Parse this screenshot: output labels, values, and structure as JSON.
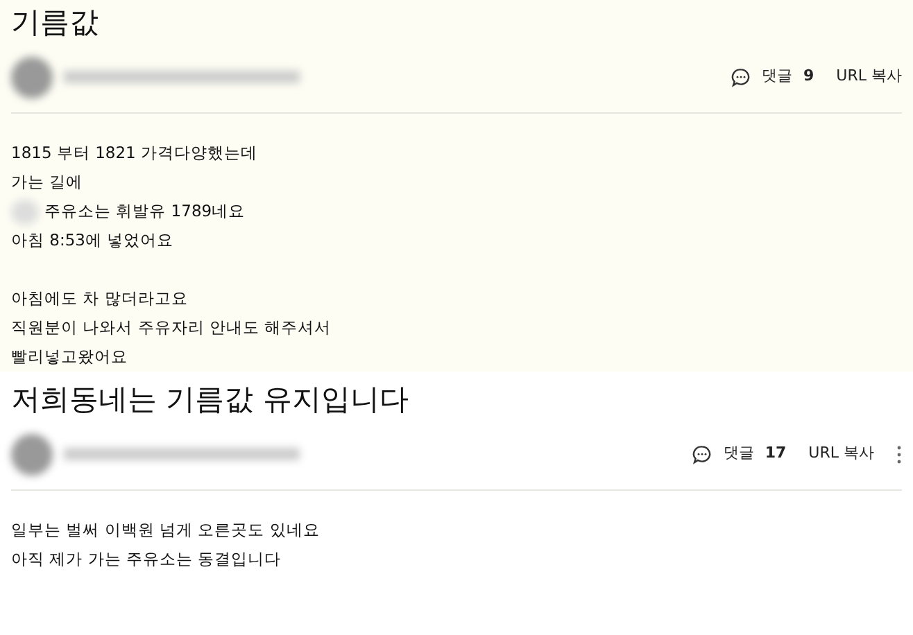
{
  "posts": [
    {
      "title": "기름값",
      "comment_label": "댓글",
      "comment_count": "9",
      "copy_url": "URL 복사",
      "has_menu": false,
      "tinted": true,
      "paragraphs": [
        [
          {
            "text": "1815 부터 1821 가격다양했는데",
            "redacted_prefix": false
          },
          {
            "text": "가는 길에",
            "redacted_prefix": false
          },
          {
            "text": "주유소는 휘발유 1789네요",
            "redacted_prefix": true
          },
          {
            "text": "아침 8:53에 넣었어요",
            "redacted_prefix": false
          }
        ],
        [
          {
            "text": "아침에도 차 많더라고요",
            "redacted_prefix": false
          },
          {
            "text": "직원분이 나와서 주유자리 안내도 해주셔서",
            "redacted_prefix": false
          },
          {
            "text": "빨리넣고왔어요",
            "redacted_prefix": false
          }
        ]
      ]
    },
    {
      "title": "저희동네는 기름값 유지입니다",
      "comment_label": "댓글",
      "comment_count": "17",
      "copy_url": "URL 복사",
      "has_menu": true,
      "tinted": false,
      "paragraphs": [
        [
          {
            "text": "일부는 벌써 이백원 넘게 오른곳도 있네요",
            "redacted_prefix": false
          },
          {
            "text": "아직 제가 가는 주유소는 동결입니다",
            "redacted_prefix": false
          }
        ]
      ]
    }
  ]
}
